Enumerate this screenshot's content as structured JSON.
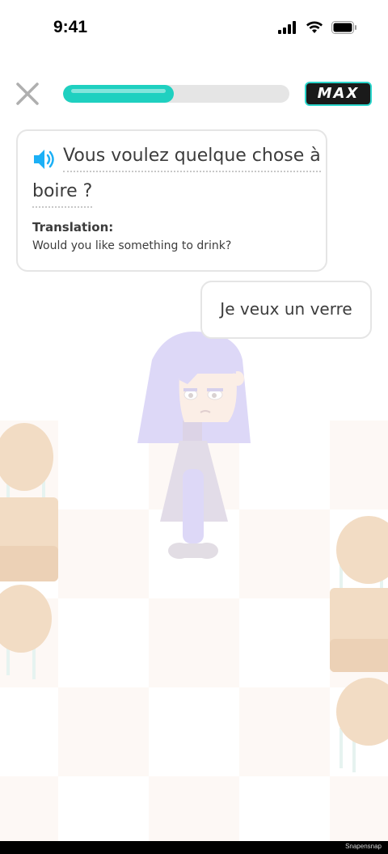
{
  "status_bar": {
    "time": "9:41"
  },
  "header": {
    "progress_fraction": 0.49,
    "max_badge": "MAX"
  },
  "prompt": {
    "line1": "Vous voulez quelque chose à",
    "line2": "boire ?",
    "translation_label": "Translation:",
    "translation_text": "Would you like something to drink?"
  },
  "answer": {
    "text": "Je veux un verre"
  },
  "colors": {
    "accent_teal": "#1fd0c0",
    "character_hair": "#ddd8f7",
    "table_wood": "#f2dcc4"
  },
  "icons": [
    "close-icon",
    "speaker-icon",
    "signal-icon",
    "wifi-icon",
    "battery-icon"
  ],
  "watermark": "Snapensnap"
}
